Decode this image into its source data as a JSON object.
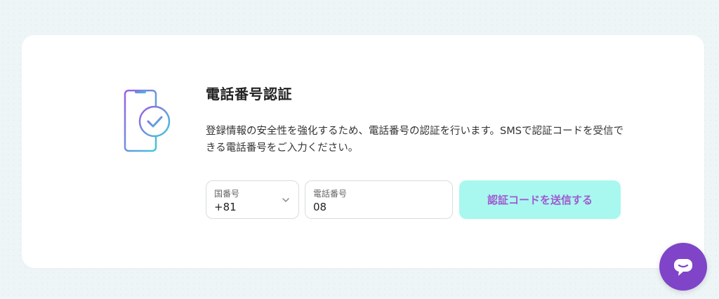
{
  "verification": {
    "title": "電話番号認証",
    "description": "登録情報の安全性を強化するため、電話番号の認証を行います。SMSで認証コードを受信できる電話番号をご入力ください。"
  },
  "form": {
    "country_label": "国番号",
    "country_value": "+81",
    "phone_label": "電話番号",
    "phone_value": "08",
    "send_button": "認証コードを送信する"
  },
  "colors": {
    "accent_purple": "#7f44c8",
    "button_bg": "#a8f8ef",
    "button_text": "#a05bd0",
    "icon_gradient_start": "#9b5de5",
    "icon_gradient_end": "#3ec9d6"
  },
  "icons": {
    "illustration": "phone-check-icon",
    "country_dropdown": "chevron-down-icon",
    "chat": "chat-bubble-icon"
  }
}
